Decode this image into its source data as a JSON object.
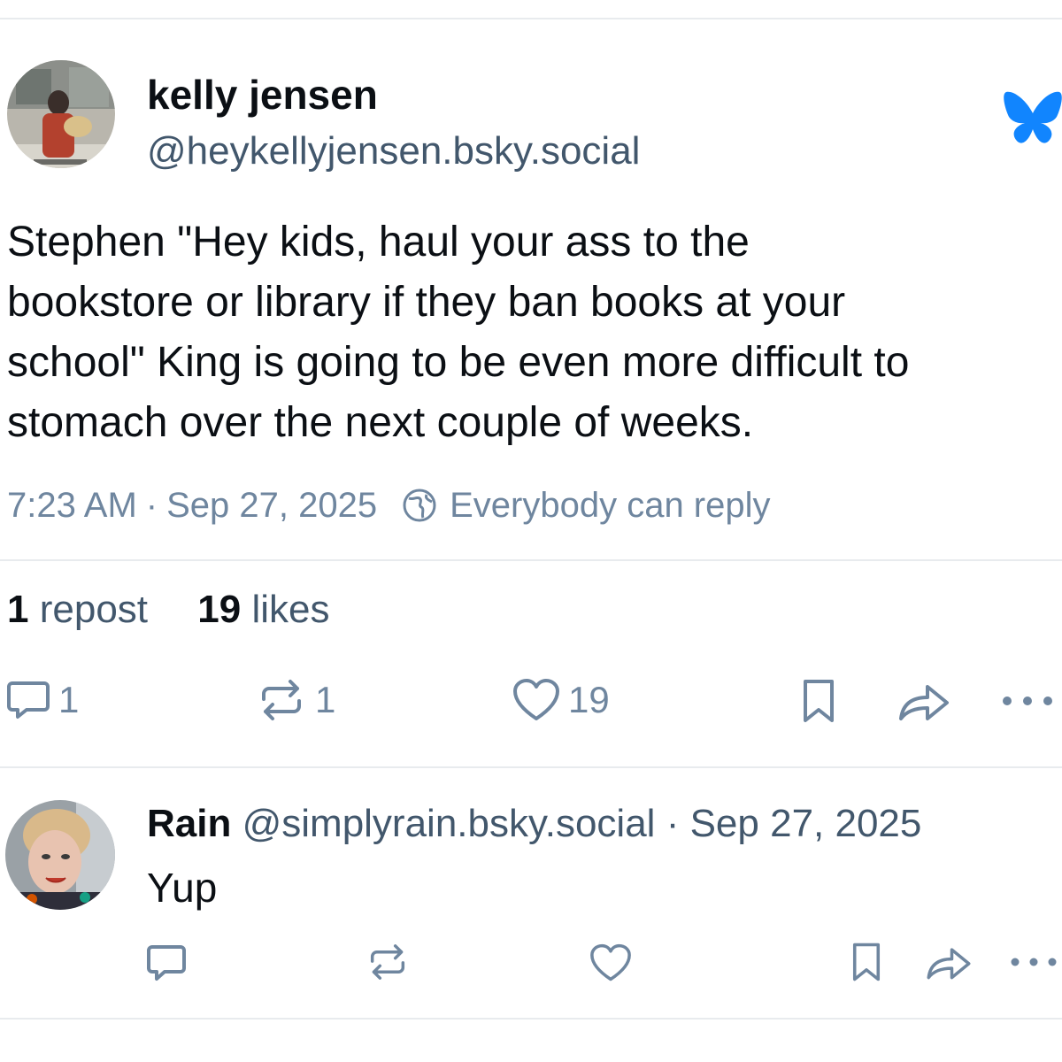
{
  "post": {
    "author_name": "kelly jensen",
    "author_handle": "@heykellyjensen.bsky.social",
    "text_lines": [
      "Stephen \"Hey kids, haul your ass to the",
      "bookstore or library if they ban books at your",
      "school\" King is going to be even more difficult to",
      "stomach over the next couple of weeks."
    ],
    "time": "7:23 AM",
    "separator": "·",
    "date": "Sep 27, 2025",
    "reply_setting": "Everybody can reply",
    "repost_count": "1",
    "repost_label": "repost",
    "like_count": "19",
    "like_label": "likes",
    "actions": {
      "reply_count": "1",
      "repost_count": "1",
      "like_count": "19"
    },
    "brand_icon": "butterfly-icon",
    "brand_color": "#1185fe"
  },
  "reply": {
    "author_name": "Rain",
    "author_handle": "@simplyrain.bsky.social",
    "separator": "·",
    "date": "Sep 27, 2025",
    "text": "Yup"
  },
  "colors": {
    "text_primary": "#0b0f14",
    "text_secondary": "#42576c",
    "text_muted": "#6f869f",
    "divider": "#e8ebee",
    "icon": "#6f869f"
  }
}
